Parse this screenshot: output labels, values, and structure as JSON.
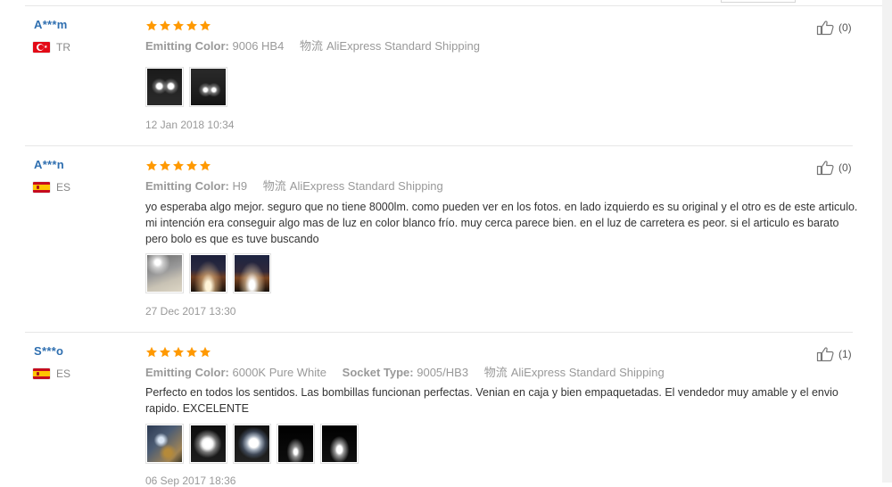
{
  "labels": {
    "emitting_color": "Emitting Color:",
    "socket_type": "Socket Type:",
    "shipping_prefix": "物流"
  },
  "colors": {
    "name": "#2f6fb0",
    "stars": "#ff9900",
    "muted": "#999999"
  },
  "reviews": [
    {
      "buyer": "A***m",
      "country": "TR",
      "flag_icon": "turkey-flag-icon",
      "rating": 5,
      "emitting_color": "9006 HB4",
      "shipping": "AliExpress Standard Shipping",
      "text": "",
      "photos": [
        "headlights-night-photo",
        "headlights-night-photo"
      ],
      "date": "12 Jan 2018 10:34",
      "helpful": "(0)"
    },
    {
      "buyer": "A***n",
      "country": "ES",
      "flag_icon": "spain-flag-icon",
      "rating": 5,
      "emitting_color": "H9",
      "shipping": "AliExpress Standard Shipping",
      "text": "yo esperaba algo mejor. seguro que no tiene 8000lm. como pueden ver en los fotos. en lado izquierdo es su original y el otro es de este articulo. mi intención era conseguir algo mas de luz en color blanco frío. muy cerca parece bien. en el luz de carretera es peor. si el articulo es barato pero bolo es que es tuve buscando",
      "photos": [
        "garage-light-photo",
        "road-night-photo",
        "road-night-photo"
      ],
      "date": "27 Dec 2017 13:30",
      "helpful": "(0)"
    },
    {
      "buyer": "S***o",
      "country": "ES",
      "flag_icon": "spain-flag-icon",
      "rating": 5,
      "emitting_color": "6000K Pure White",
      "socket_type": "9005/HB3",
      "shipping": "AliExpress Standard Shipping",
      "text": "Perfecto en todos los sentidos. Las bombillas funcionan perfectas. Venian en caja y bien empaquetadas. El vendedor muy amable y el envio rapido. EXCELENTE",
      "photos": [
        "engine-bay-photo",
        "headlight-bulb-photo",
        "headlight-glow-photo",
        "dark-beam-photo",
        "dark-beam-photo"
      ],
      "date": "06 Sep 2017 18:36",
      "helpful": "(1)"
    }
  ]
}
